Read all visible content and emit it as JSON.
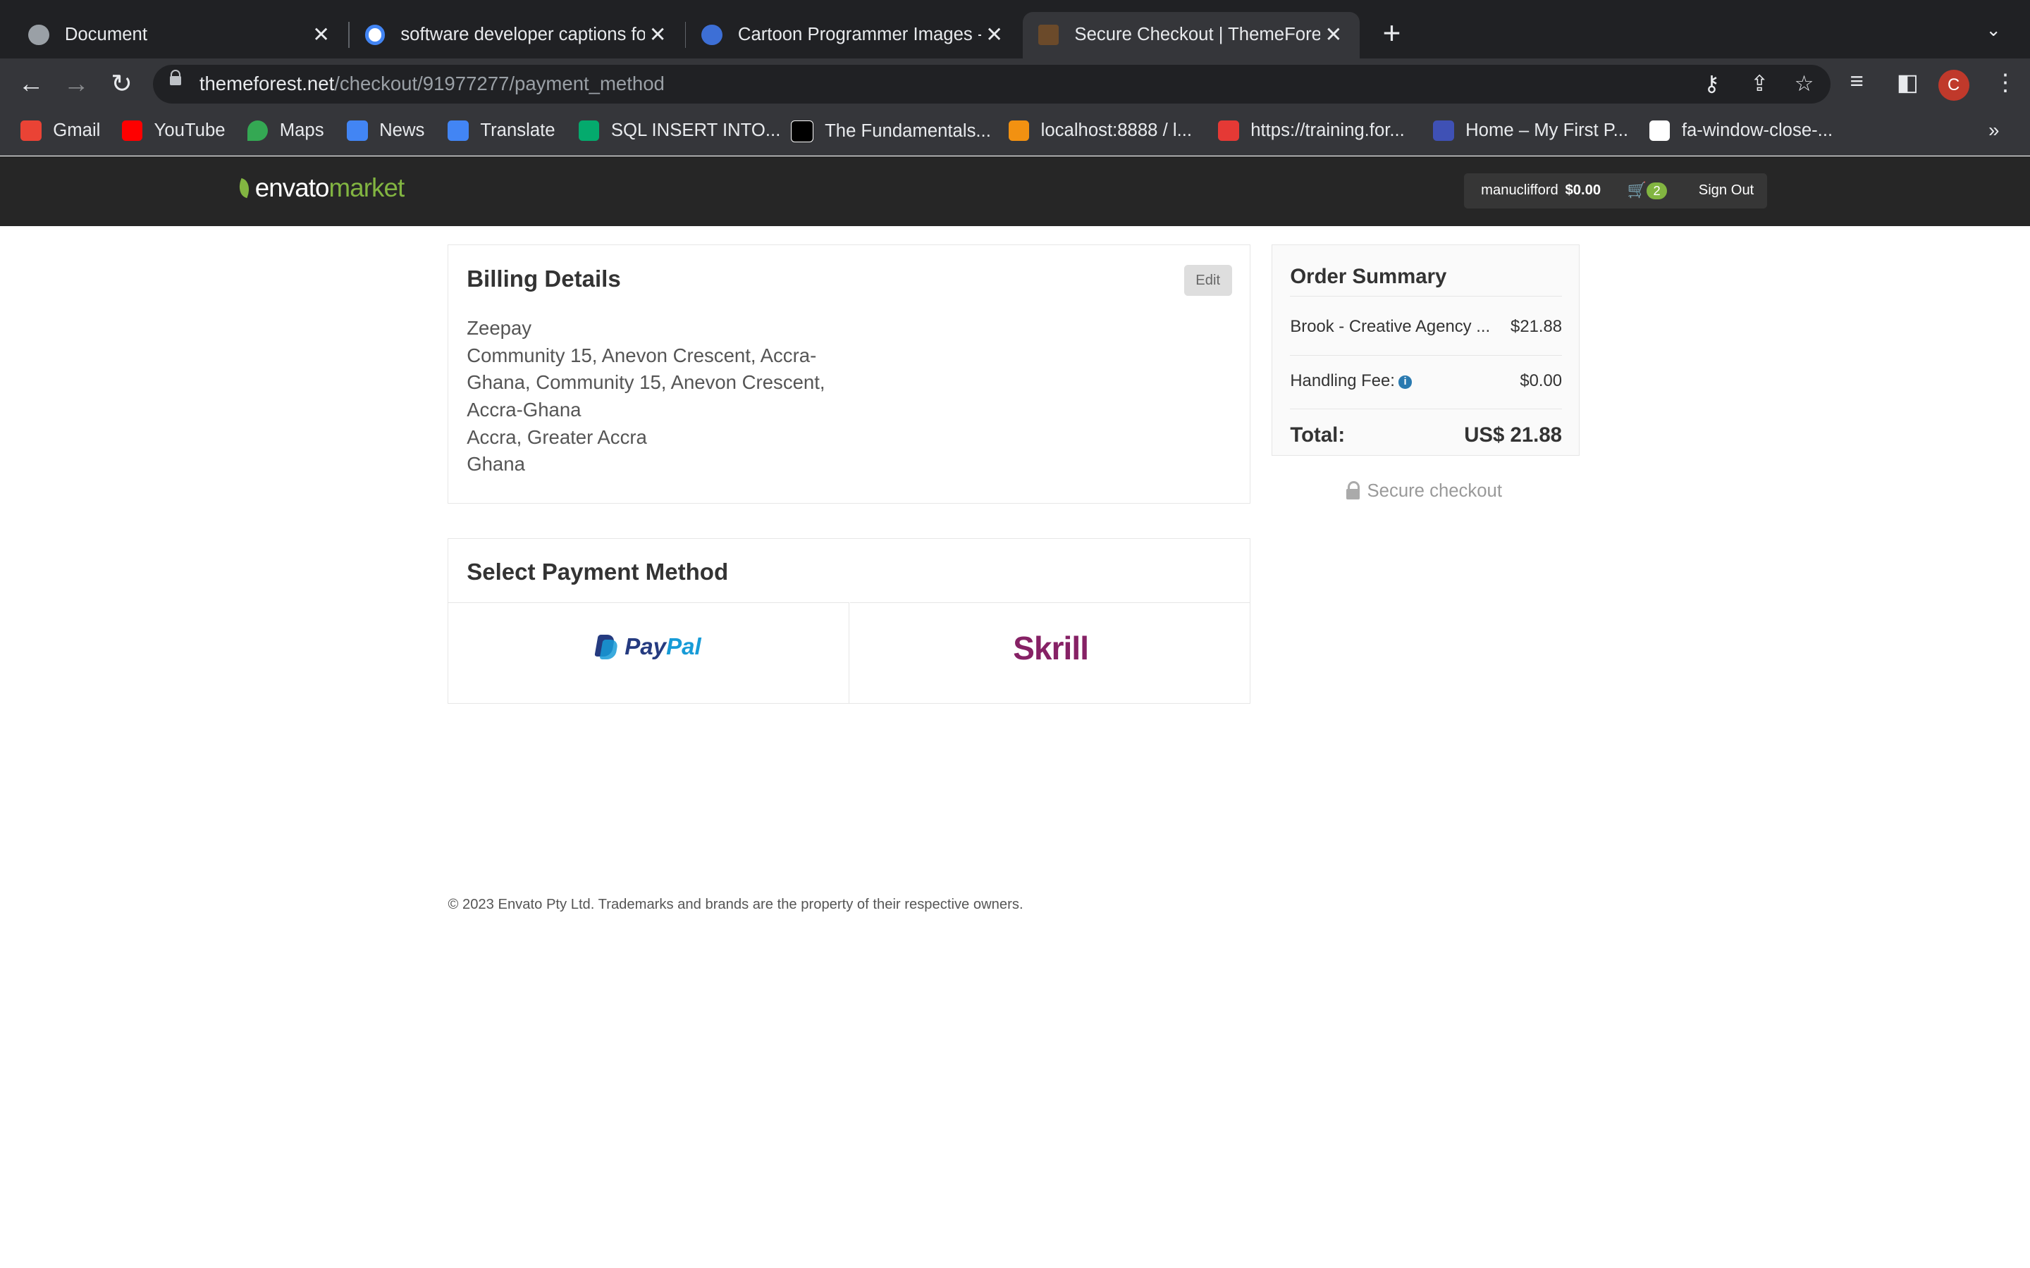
{
  "browser": {
    "tabs": [
      {
        "title": "Document",
        "icon": "globe-icon",
        "active": false
      },
      {
        "title": "software developer captions fo",
        "icon": "google-icon",
        "active": false
      },
      {
        "title": "Cartoon Programmer Images -",
        "icon": "cartoon-icon",
        "active": false
      },
      {
        "title": "Secure Checkout | ThemeFores",
        "icon": "themeforest-icon",
        "active": true
      }
    ],
    "url_host": "themeforest.net",
    "url_path": "/checkout/91977277/payment_method",
    "profile_initial": "C",
    "bookmarks": [
      {
        "label": "Gmail",
        "icon": "gmail-icon",
        "color": "#ea4335"
      },
      {
        "label": "YouTube",
        "icon": "youtube-icon",
        "color": "#ff0000"
      },
      {
        "label": "Maps",
        "icon": "maps-icon",
        "color": "#34a853"
      },
      {
        "label": "News",
        "icon": "news-icon",
        "color": "#4285f4"
      },
      {
        "label": "Translate",
        "icon": "translate-icon",
        "color": "#4285f4"
      },
      {
        "label": "SQL INSERT INTO...",
        "icon": "w3schools-icon",
        "color": "#04aa6d"
      },
      {
        "label": "The Fundamentals...",
        "icon": "medium-icon",
        "color": "#000000"
      },
      {
        "label": "localhost:8888 / l...",
        "icon": "phpmyadmin-icon",
        "color": "#f29111"
      },
      {
        "label": "https://training.for...",
        "icon": "training-icon",
        "color": "#e53935"
      },
      {
        "label": "Home – My First P...",
        "icon": "site-icon",
        "color": "#3f51b5"
      },
      {
        "label": "fa-window-close-...",
        "icon": "flag-icon",
        "color": "#ffffff"
      }
    ]
  },
  "site": {
    "logo_envato": "envato",
    "logo_market": "market",
    "username": "manuclifford",
    "balance": "$0.00",
    "cart_count": "2",
    "sign_out": "Sign Out",
    "accent": "#82b541"
  },
  "billing": {
    "title": "Billing Details",
    "edit_label": "Edit",
    "lines": [
      "Zeepay",
      "Community 15, Anevon Crescent, Accra-",
      "Ghana, Community 15, Anevon Crescent,",
      "Accra-Ghana",
      "Accra, Greater Accra",
      "Ghana"
    ]
  },
  "payment": {
    "title": "Select Payment Method",
    "paypal_a": "Pay",
    "paypal_b": "Pal",
    "skrill": "Skrill"
  },
  "order": {
    "title": "Order Summary",
    "item_label": "Brook - Creative Agency ...",
    "item_price": "$21.88",
    "fee_label": "Handling Fee:",
    "fee_value": "$0.00",
    "total_label": "Total:",
    "total_value": "US$ 21.88",
    "secure_label": "Secure checkout"
  },
  "footer": "© 2023 Envato Pty Ltd. Trademarks and brands are the property of their respective owners."
}
